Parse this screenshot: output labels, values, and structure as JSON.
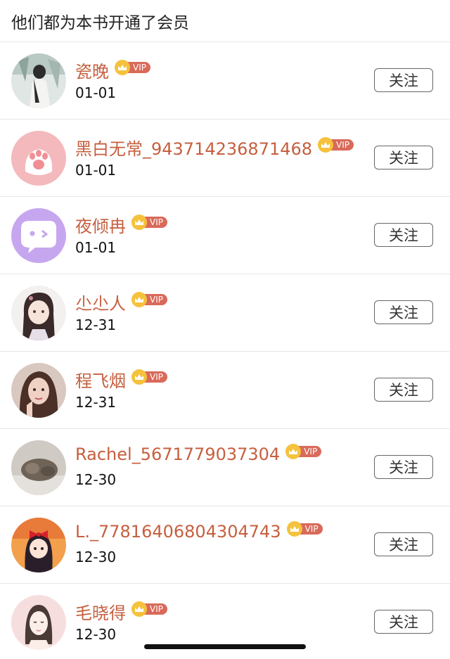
{
  "header": {
    "title": "他们都为本书开通了会员"
  },
  "members": [
    {
      "name": "瓷晚",
      "vip_label": "VIP",
      "date": "01-01",
      "follow_label": "关注",
      "avatar_icon": "photo-avatar-girl-white-dress"
    },
    {
      "name": "黑白无常_943714236871468",
      "vip_label": "VIP",
      "date": "01-01",
      "follow_label": "关注",
      "avatar_icon": "pink-paw-avatar"
    },
    {
      "name": "夜倾冉",
      "vip_label": "VIP",
      "date": "01-01",
      "follow_label": "关注",
      "avatar_icon": "purple-chat-bubble-avatar"
    },
    {
      "name": "尐尐人",
      "vip_label": "VIP",
      "date": "12-31",
      "follow_label": "关注",
      "avatar_icon": "anime-girl-avatar"
    },
    {
      "name": "程飞烟",
      "vip_label": "VIP",
      "date": "12-31",
      "follow_label": "关注",
      "avatar_icon": "photo-avatar-woman"
    },
    {
      "name": "Rachel_5671779037304",
      "vip_label": "VIP",
      "date": "12-30",
      "follow_label": "关注",
      "avatar_icon": "photo-avatar-cat"
    },
    {
      "name": "L._77816406804304743",
      "vip_label": "VIP",
      "date": "12-30",
      "follow_label": "关注",
      "avatar_icon": "cartoon-girl-red-bow-avatar"
    },
    {
      "name": "毛晓得",
      "vip_label": "VIP",
      "date": "12-30",
      "follow_label": "关注",
      "avatar_icon": "drawn-woman-avatar"
    }
  ],
  "colors": {
    "name": "#c65f3f",
    "vip_badge": "#d96a5a",
    "crown": "#f5c23d",
    "divider": "#e6e6e6"
  }
}
